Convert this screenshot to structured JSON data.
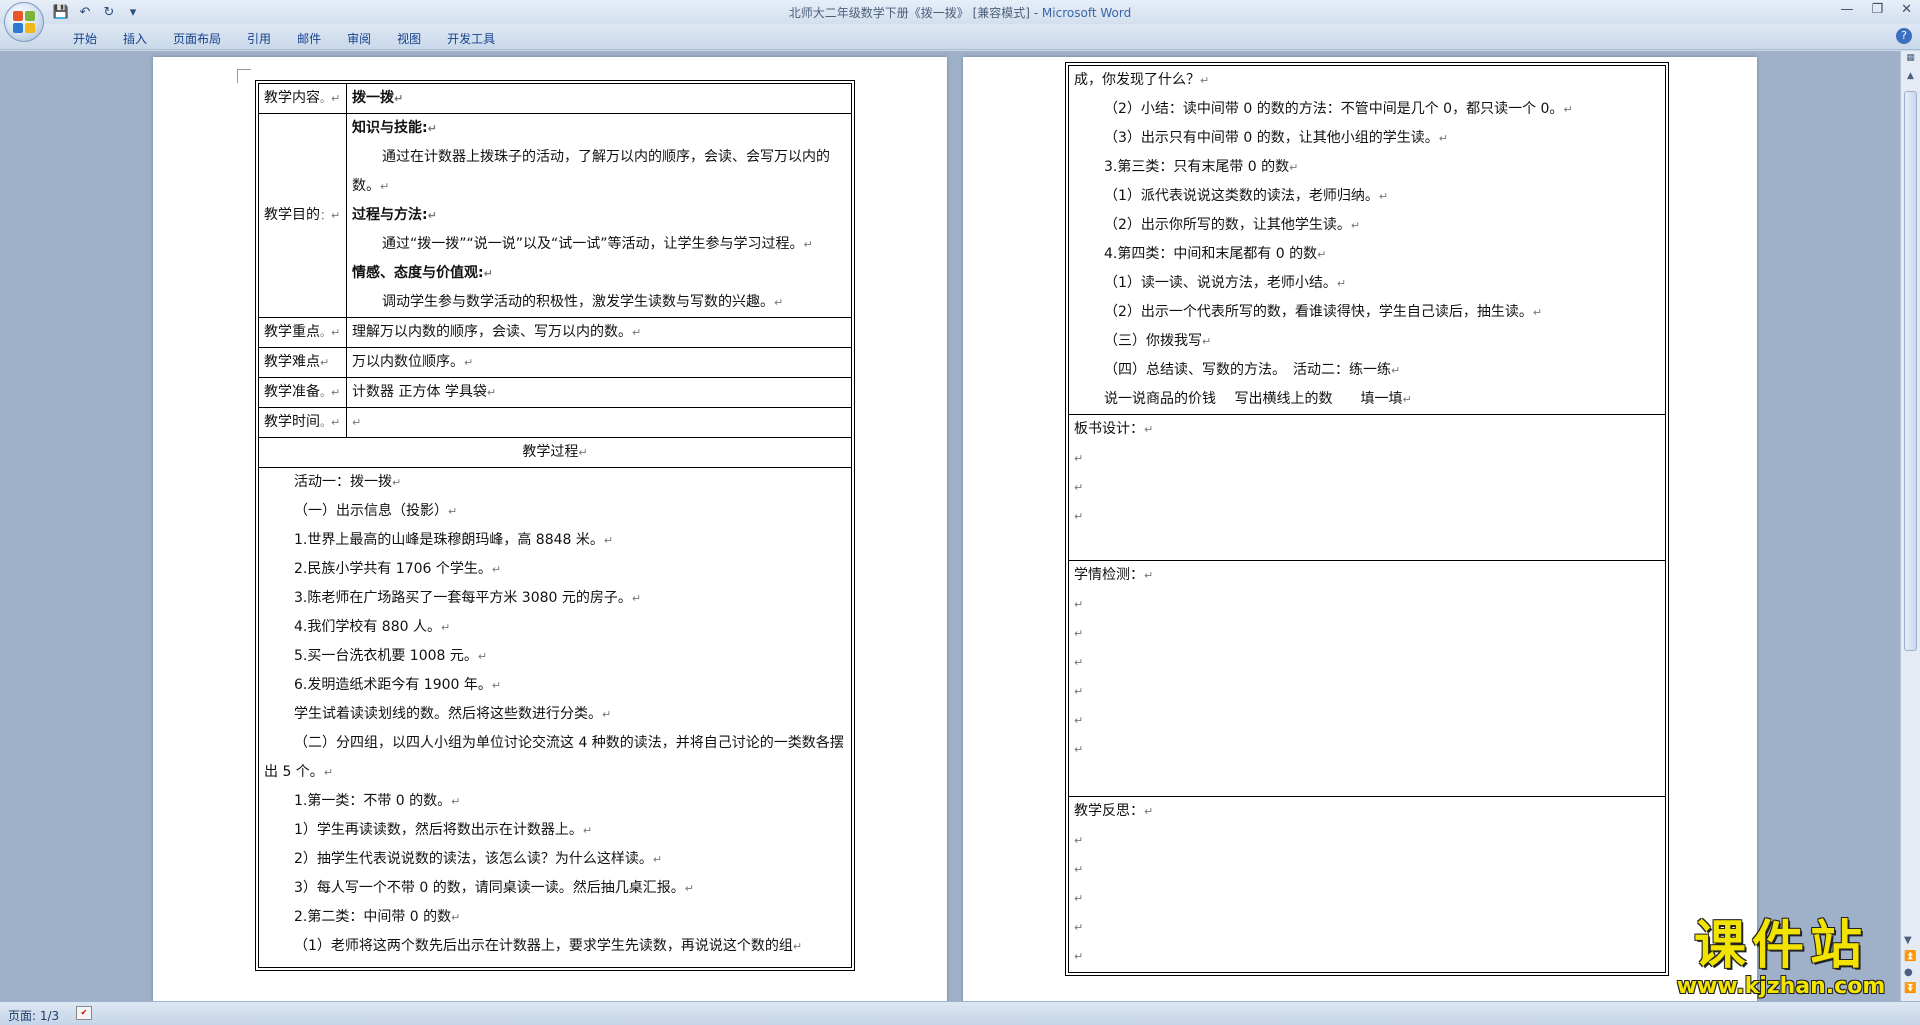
{
  "window": {
    "title": "北师大二年级数学下册《拨一拨》 [兼容模式] - ",
    "app_name": "Microsoft Word"
  },
  "qat": {
    "save_icon": "💾",
    "undo_icon": "↶",
    "redo_icon": "↻",
    "more_icon": "▾"
  },
  "tabs": [
    "开始",
    "插入",
    "页面布局",
    "引用",
    "邮件",
    "审阅",
    "视图",
    "开发工具"
  ],
  "status": {
    "page": "页面: 1/3"
  },
  "page1": {
    "content_label": "教学内容",
    "content_value": "拨一拨",
    "goal_label": "教学目的",
    "goal_heading1": "知识与技能:",
    "goal_text1": "通过在计数器上拨珠子的活动，了解万以内的顺序，会读、会写万以内的数。",
    "goal_heading2": "过程与方法:",
    "goal_text2": "通过“拨一拨”“说一说”以及“试一试”等活动，让学生参与学习过程。",
    "goal_heading3": "情感、态度与价值观:",
    "goal_text3": "调动学生参与数学活动的积极性，激发学生读数与写数的兴趣。",
    "key_label": "教学重点",
    "key_value": "理解万以内数的顺序，会读、写万以内的数。",
    "hard_label": "教学难点",
    "hard_value": "万以内数位顺序。",
    "prep_label": "教学准备",
    "prep_value": "计数器 正方体 学具袋",
    "time_label": "教学时间",
    "process_label": "教学过程",
    "process_lines": [
      "活动一：拨一拨",
      "（一）出示信息（投影）",
      "1.世界上最高的山峰是珠穆朗玛峰，高 8848 米。",
      "2.民族小学共有 1706 个学生。",
      "3.陈老师在广场路买了一套每平方米 3080 元的房子。",
      "4.我们学校有 880 人。",
      "5.买一台洗衣机要 1008 元。",
      "6.发明造纸术距今有 1900 年。",
      "学生试着读读划线的数。然后将这些数进行分类。",
      "（二）分四组，以四人小组为单位讨论交流这 4 种数的读法，并将自己讨论的一类数各摆出 5 个。",
      "1.第一类：不带 0 的数。",
      "1）学生再读读数，然后将数出示在计数器上。",
      "2）抽学生代表说说数的读法，该怎么读？为什么这样读。",
      "3）每人写一个不带 0 的数，请同桌读一读。然后抽几桌汇报。",
      "2.第二类：中间带 0 的数",
      "（1）老师将这两个数先后出示在计数器上，要求学生先读数，再说说这个数的组"
    ]
  },
  "page2": {
    "process_lines": [
      "成，你发现了什么？",
      "（2）小结：读中间带 0 的数的方法：不管中间是几个 0，都只读一个 0。",
      "（3）出示只有中间带 0 的数，让其他小组的学生读。",
      "3.第三类：只有末尾带 0 的数",
      "（1）派代表说说这类数的读法，老师归纳。",
      "（2）出示你所写的数，让其他学生读。",
      "4.第四类：中间和末尾都有 0 的数",
      "（1）读一读、说说方法，老师小结。",
      "（2）出示一个代表所写的数，看谁读得快，学生自己读后，抽生读。",
      "（三）你拨我写",
      "（四）总结读、写数的方法。　活动二：练一练",
      "说一说商品的价钱　 写出横线上的数　　填一填"
    ],
    "board_label": "板书设计：",
    "check_label": "学情检测：",
    "reflect_label": "教学反思："
  },
  "watermark": {
    "cn": "课件站",
    "url": "www.kjzhan.com"
  }
}
